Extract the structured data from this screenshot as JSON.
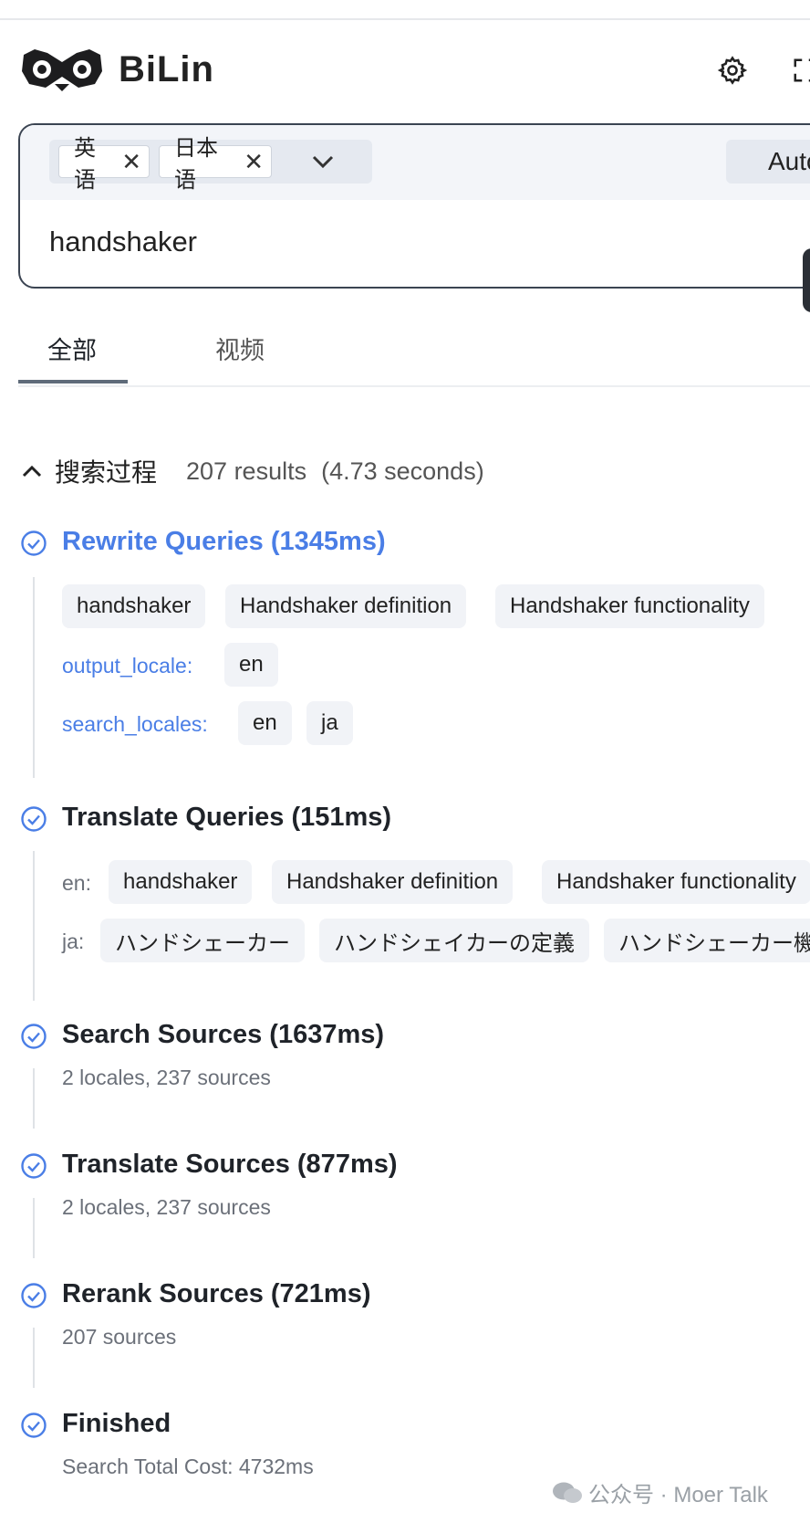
{
  "app": {
    "name": "BiLin"
  },
  "search": {
    "locale_tags": [
      "英语",
      "日本语"
    ],
    "remove_glyph": "✕",
    "mode_label": "Auto",
    "query": "handshaker"
  },
  "tabs": [
    {
      "label": "全部",
      "active": true
    },
    {
      "label": "视频",
      "active": false
    }
  ],
  "process": {
    "title": "搜索过程",
    "results": "207 results",
    "time": "(4.73 seconds)"
  },
  "steps": {
    "rewrite": {
      "title": "Rewrite Queries (1345ms)",
      "queries": [
        "handshaker",
        "Handshaker definition",
        "Handshaker functionality"
      ],
      "output_locale_label": "output_locale:",
      "output_locale": "en",
      "search_locales_label": "search_locales:",
      "search_locales": [
        "en",
        "ja"
      ]
    },
    "translate": {
      "title": "Translate Queries (151ms)",
      "en_label": "en:",
      "en_queries": [
        "handshaker",
        "Handshaker definition",
        "Handshaker functionality"
      ],
      "ja_label": "ja:",
      "ja_queries": [
        "ハンドシェーカー",
        "ハンドシェイカーの定義",
        "ハンドシェーカー機"
      ]
    },
    "search_sources": {
      "title": "Search Sources (1637ms)",
      "detail": "2 locales, 237 sources"
    },
    "translate_sources": {
      "title": "Translate Sources (877ms)",
      "detail": "2 locales, 237 sources"
    },
    "rerank_sources": {
      "title": "Rerank Sources (721ms)",
      "detail": "207 sources"
    },
    "finished": {
      "title": "Finished",
      "detail": "Search Total Cost: 4732ms"
    }
  },
  "watermark": {
    "text": "公众号 · Moer Talk"
  },
  "colors": {
    "accent": "#4a7ee6",
    "chip_bg": "#f1f3f7",
    "text": "#1f2329"
  }
}
